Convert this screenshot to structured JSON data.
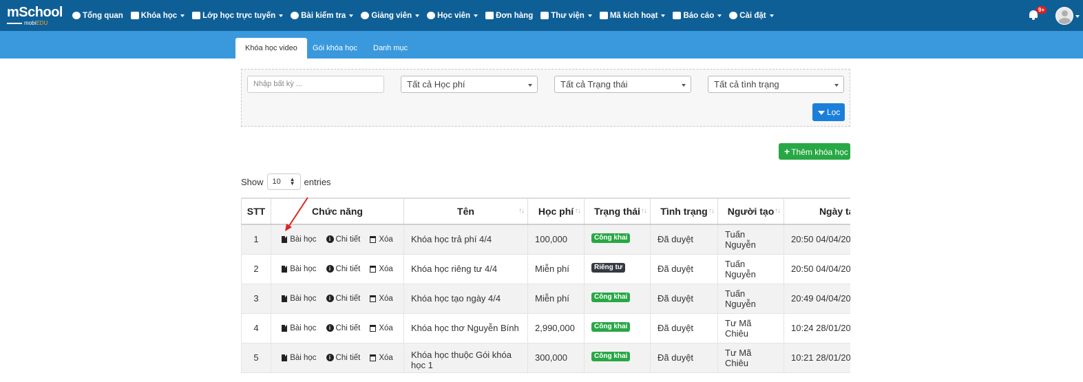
{
  "navbar": {
    "logo_brand_a": "m",
    "logo_brand_b": "S",
    "logo_brand_c": "chool",
    "logo_sub_a": "mobi",
    "logo_sub_b": "EDU",
    "items": [
      {
        "label": "Tổng quan",
        "caret": false
      },
      {
        "label": "Khóa học",
        "caret": true
      },
      {
        "label": "Lớp học trực tuyến",
        "caret": true
      },
      {
        "label": "Bài kiểm tra",
        "caret": true
      },
      {
        "label": "Giảng viên",
        "caret": true
      },
      {
        "label": "Học viên",
        "caret": true
      },
      {
        "label": "Đơn hàng",
        "caret": false
      },
      {
        "label": "Thư viện",
        "caret": true
      },
      {
        "label": "Mã kích hoạt",
        "caret": true
      },
      {
        "label": "Báo cáo",
        "caret": true
      },
      {
        "label": "Cài đặt",
        "caret": true
      }
    ],
    "notification_count": "9+"
  },
  "tabs": [
    {
      "label": "Khóa học video",
      "active": true
    },
    {
      "label": "Gói khóa học",
      "active": false
    },
    {
      "label": "Danh mục",
      "active": false
    }
  ],
  "filter": {
    "search_placeholder": "Nhập bất kỳ ...",
    "fee_select": "Tất cả Học phí",
    "status_select": "Tất cả Trạng thái",
    "condition_select": "Tất cả tình trạng",
    "filter_button": "Lọc"
  },
  "add_button": "Thêm khóa học",
  "entries": {
    "show_label": "Show",
    "value": "10",
    "entries_label": "entries"
  },
  "table": {
    "headers": [
      "STT",
      "Chức năng",
      "Tên",
      "Học phí",
      "Trạng thái",
      "Tình trạng",
      "Người tạo",
      "Ngày tạo"
    ],
    "action_labels": {
      "lessons": "Bài học",
      "detail": "Chi tiết",
      "delete": "Xóa"
    },
    "rows": [
      {
        "stt": "1",
        "name": "Khóa học trả phí 4/4",
        "fee": "100,000",
        "status": "Công khai",
        "condition": "Đã duyệt",
        "creator": "Tuấn Nguyễn",
        "created": "20:50 04/04/20"
      },
      {
        "stt": "2",
        "name": "Khóa học riêng tư 4/4",
        "fee": "Miễn phí",
        "status": "Riêng tư",
        "condition": "Đã duyệt",
        "creator": "Tuấn Nguyễn",
        "created": "20:50 04/04/20"
      },
      {
        "stt": "3",
        "name": "Khóa học tạo ngày 4/4",
        "fee": "Miễn phí",
        "status": "Công khai",
        "condition": "Đã duyệt",
        "creator": "Tuấn Nguyễn",
        "created": "20:49 04/04/20"
      },
      {
        "stt": "4",
        "name": "Khóa học thơ Nguyễn Bính",
        "fee": "2,990,000",
        "status": "Công khai",
        "condition": "Đã duyệt",
        "creator": "Tư Mã Chiêu",
        "created": "10:24 28/01/20"
      },
      {
        "stt": "5",
        "name": "Khóa học thuộc Gói khóa học 1",
        "fee": "300,000",
        "status": "Công khai",
        "condition": "Đã duyệt",
        "creator": "Tư Mã Chiêu",
        "created": "10:21 28/01/20"
      }
    ]
  },
  "colors": {
    "navbar_bg": "#0f5f97",
    "subnav_bg": "#3a99dd",
    "filter_button": "#1a7fd9",
    "add_button": "#27a844",
    "public_badge": "#28a745",
    "private_badge": "#343a40",
    "annotation_arrow": "#e02020"
  }
}
